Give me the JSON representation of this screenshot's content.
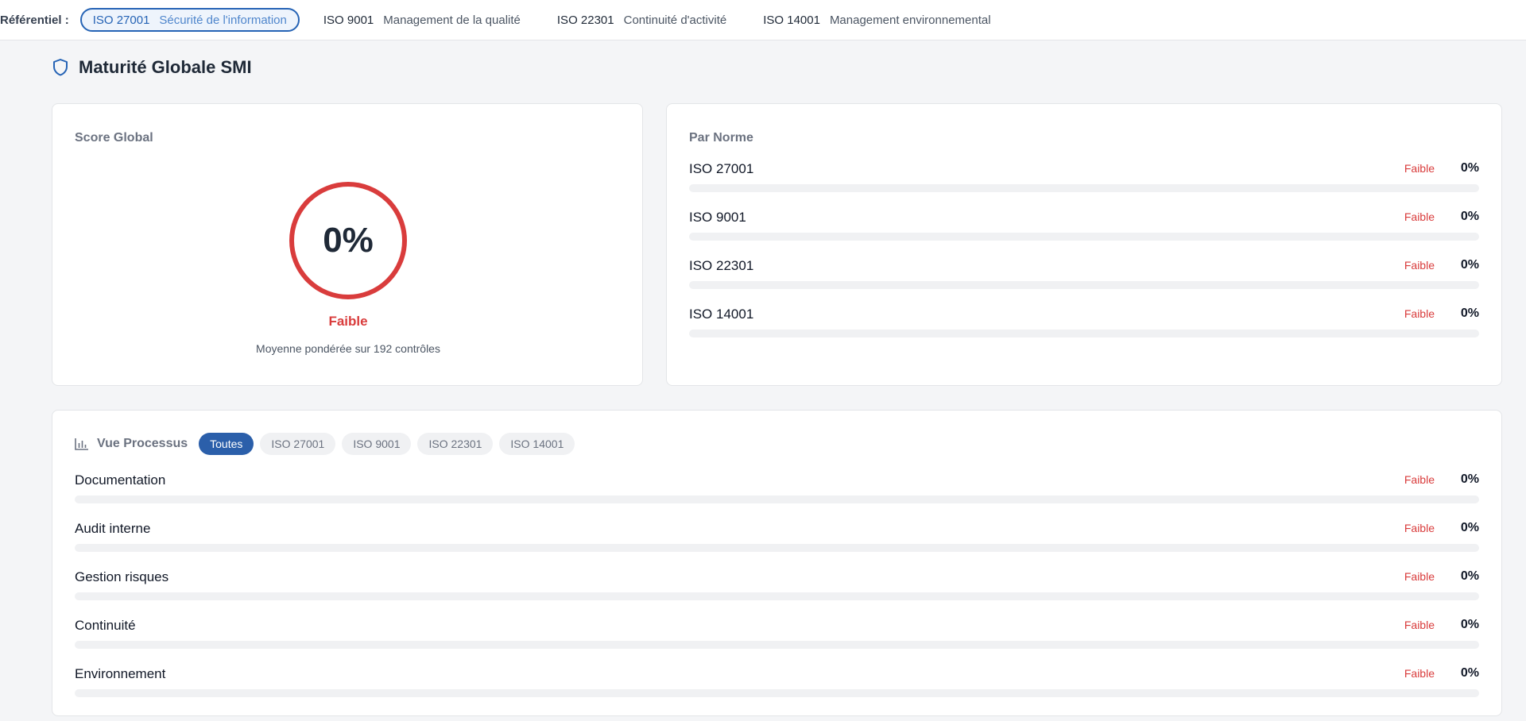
{
  "topbar": {
    "label": "Référentiel :",
    "standards": [
      {
        "code": "ISO 27001",
        "desc": "Sécurité de l'information",
        "active": true
      },
      {
        "code": "ISO 9001",
        "desc": "Management de la qualité",
        "active": false
      },
      {
        "code": "ISO 22301",
        "desc": "Continuité d'activité",
        "active": false
      },
      {
        "code": "ISO 14001",
        "desc": "Management environnemental",
        "active": false
      }
    ]
  },
  "page": {
    "title": "Maturité Globale SMI",
    "icon": "shield-icon"
  },
  "score": {
    "title": "Score Global",
    "value": "0%",
    "progress": 0,
    "level": "Faible",
    "subtitle": "Moyenne pondérée sur 192 contrôles"
  },
  "norms": {
    "title": "Par Norme",
    "items": [
      {
        "label": "ISO 27001",
        "level": "Faible",
        "pct": "0%",
        "progress": 0
      },
      {
        "label": "ISO 9001",
        "level": "Faible",
        "pct": "0%",
        "progress": 0
      },
      {
        "label": "ISO 22301",
        "level": "Faible",
        "pct": "0%",
        "progress": 0
      },
      {
        "label": "ISO 14001",
        "level": "Faible",
        "pct": "0%",
        "progress": 0
      }
    ]
  },
  "process": {
    "title": "Vue Processus",
    "icon": "bar-chart-icon",
    "filters": [
      {
        "label": "Toutes",
        "active": true
      },
      {
        "label": "ISO 27001",
        "active": false
      },
      {
        "label": "ISO 9001",
        "active": false
      },
      {
        "label": "ISO 22301",
        "active": false
      },
      {
        "label": "ISO 14001",
        "active": false
      }
    ],
    "items": [
      {
        "label": "Documentation",
        "level": "Faible",
        "pct": "0%",
        "progress": 0
      },
      {
        "label": "Audit interne",
        "level": "Faible",
        "pct": "0%",
        "progress": 0
      },
      {
        "label": "Gestion risques",
        "level": "Faible",
        "pct": "0%",
        "progress": 0
      },
      {
        "label": "Continuité",
        "level": "Faible",
        "pct": "0%",
        "progress": 0
      },
      {
        "label": "Environnement",
        "level": "Faible",
        "pct": "0%",
        "progress": 0
      }
    ]
  },
  "colors": {
    "accent": "#2563b5",
    "danger": "#d93c3c",
    "track": "#f0f1f3"
  }
}
